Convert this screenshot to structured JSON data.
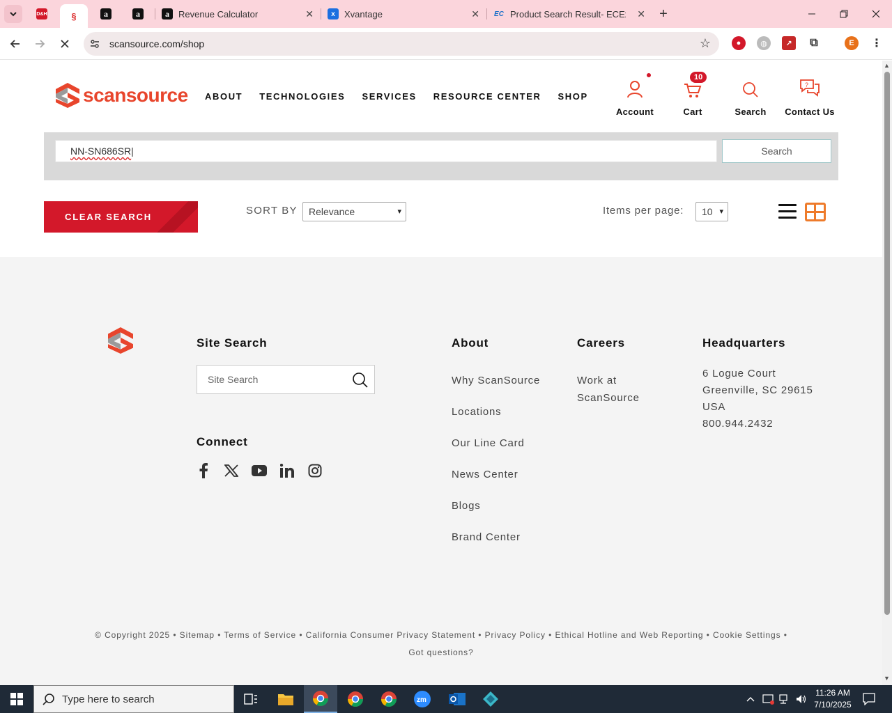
{
  "browser": {
    "tabs": [
      {
        "title": "Revenue Calculator"
      },
      {
        "title": "Xvantage"
      },
      {
        "title": "Product Search Result- ECExpress"
      }
    ],
    "url": "scansource.com/shop",
    "profile_initial": "E"
  },
  "header": {
    "logo_text": "scansource",
    "nav": [
      "ABOUT",
      "TECHNOLOGIES",
      "SERVICES",
      "RESOURCE CENTER",
      "SHOP"
    ],
    "account_label": "Account",
    "cart_label": "Cart",
    "cart_count": "10",
    "search_label": "Search",
    "contact_label": "Contact Us"
  },
  "search": {
    "query": "NN-SN686SR",
    "button_label": "Search"
  },
  "controls": {
    "clear_label": "CLEAR SEARCH",
    "sort_label": "SORT BY",
    "sort_value": "Relevance",
    "ipp_label": "Items per page:",
    "ipp_value": "10"
  },
  "footer": {
    "site_search_heading": "Site Search",
    "site_search_placeholder": "Site Search",
    "connect_heading": "Connect",
    "about_heading": "About",
    "about_links": [
      "Why ScanSource",
      "Locations",
      "Our Line Card",
      "News Center",
      "Blogs",
      "Brand Center"
    ],
    "careers_heading": "Careers",
    "careers_link": "Work at ScanSource",
    "hq_heading": "Headquarters",
    "hq_lines": [
      "6 Logue Court",
      "Greenville, SC 29615",
      "USA",
      "800.944.2432"
    ],
    "legal_line1": "© Copyright 2025 • Sitemap • Terms of Service • California Consumer Privacy Statement • Privacy Policy • Ethical Hotline and Web Reporting • Cookie Settings •",
    "legal_line2": "Got questions?"
  },
  "taskbar": {
    "search_placeholder": "Type here to search",
    "time": "11:26 AM",
    "date": "7/10/2025"
  },
  "colors": {
    "brand_red": "#d3182a",
    "brand_orange": "#e8452c",
    "grid_orange": "#ee7b2b"
  }
}
